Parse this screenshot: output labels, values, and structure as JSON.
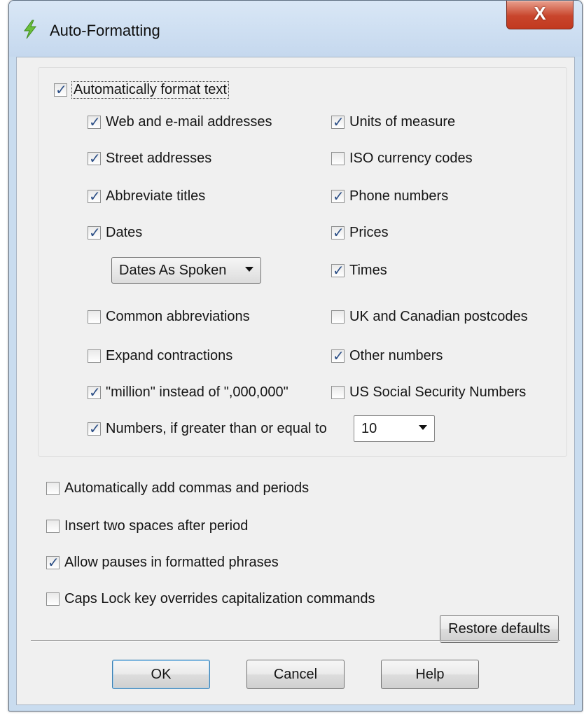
{
  "window": {
    "title": "Auto-Formatting",
    "close_label": "X"
  },
  "icons": {
    "app": "lightning-bolt-icon",
    "accent": "#6abf3b"
  },
  "master": {
    "label": "Automatically format text",
    "checked": true
  },
  "left_column": [
    {
      "id": "web-email",
      "label": "Web and e-mail addresses",
      "checked": true
    },
    {
      "id": "street",
      "label": "Street addresses",
      "checked": true
    },
    {
      "id": "abbrev-titles",
      "label": "Abbreviate titles",
      "checked": true
    },
    {
      "id": "dates",
      "label": "Dates",
      "checked": true
    }
  ],
  "dates_combo": {
    "value": "Dates As Spoken"
  },
  "left_column_lower": [
    {
      "id": "common-abbrev",
      "label": "Common abbreviations",
      "checked": false
    },
    {
      "id": "expand-contractions",
      "label": "Expand contractions",
      "checked": false
    },
    {
      "id": "million",
      "label": "\"million\" instead of \",000,000\"",
      "checked": true
    }
  ],
  "right_column": [
    {
      "id": "units",
      "label": "Units of measure",
      "checked": true
    },
    {
      "id": "iso-currency",
      "label": "ISO currency codes",
      "checked": false
    },
    {
      "id": "phone",
      "label": "Phone numbers",
      "checked": true
    },
    {
      "id": "prices",
      "label": "Prices",
      "checked": true
    },
    {
      "id": "times",
      "label": "Times",
      "checked": true
    },
    {
      "id": "uk-postcodes",
      "label": "UK and Canadian postcodes",
      "checked": false
    },
    {
      "id": "other-numbers",
      "label": "Other numbers",
      "checked": true
    },
    {
      "id": "us-ssn",
      "label": "US Social Security Numbers",
      "checked": false
    }
  ],
  "numbers_row": {
    "label": "Numbers, if greater than or equal to",
    "checked": true,
    "value": "10"
  },
  "lower_options": [
    {
      "id": "commas-periods",
      "label": "Automatically add commas and periods",
      "checked": false
    },
    {
      "id": "two-spaces",
      "label": "Insert two spaces after period",
      "checked": false
    },
    {
      "id": "allow-pauses",
      "label": "Allow pauses in formatted phrases",
      "checked": true
    },
    {
      "id": "caps-lock",
      "label": "Caps Lock key overrides capitalization commands",
      "checked": false
    }
  ],
  "buttons": {
    "restore": "Restore defaults",
    "ok": "OK",
    "cancel": "Cancel",
    "help": "Help"
  }
}
